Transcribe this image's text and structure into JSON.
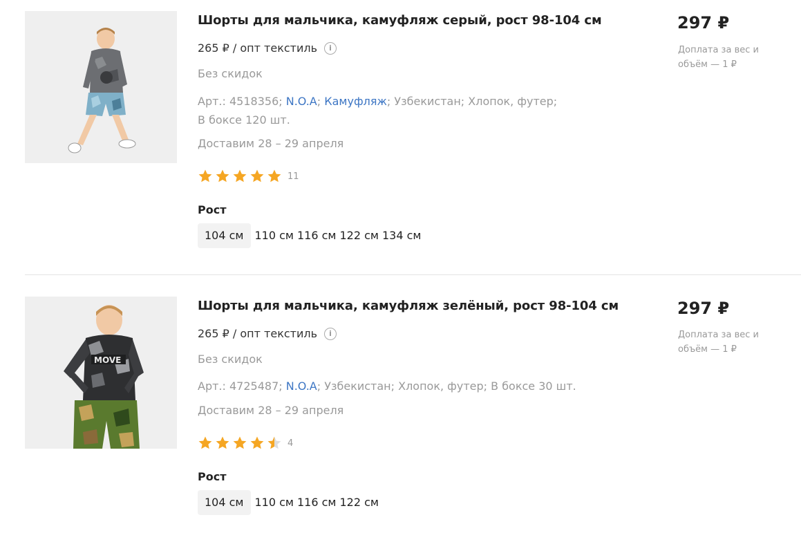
{
  "products": [
    {
      "title": "Шорты для мальчика, камуфляж серый, рост 98-104 см",
      "wholesale_price": "265 ₽ / опт текстиль",
      "discount": "Без скидок",
      "article_prefix": "Арт.: 4518356; ",
      "brand": "N.O.A",
      "sep1": "; ",
      "collection": "Камуфляж",
      "meta_rest": "; Узбекистан; Хлопок, футер;",
      "box": "В боксе 120 шт.",
      "delivery": "Доставим 28 – 29 апреля",
      "rating": 5,
      "rating_count": "11",
      "size_label": "Рост",
      "sizes": [
        "104 см",
        "110 см",
        "116 см",
        "122 см",
        "134 см"
      ],
      "price": "297 ₽",
      "surcharge": "Доплата за вес и объём — 1 ₽"
    },
    {
      "title": "Шорты для мальчика, камуфляж зелёный, рост 98-104 см",
      "wholesale_price": "265 ₽ / опт текстиль",
      "discount": "Без скидок",
      "article_prefix": "Арт.: 4725487; ",
      "brand": "N.O.A",
      "meta_rest": "; Узбекистан; Хлопок, футер; В боксе 30 шт.",
      "delivery": "Доставим 28 – 29 апреля",
      "rating": 4.5,
      "rating_count": "4",
      "size_label": "Рост",
      "sizes": [
        "104 см",
        "110 см",
        "116 см",
        "122 см"
      ],
      "price": "297 ₽",
      "surcharge": "Доплата за вес и объём — 1 ₽"
    }
  ],
  "colors": {
    "star": "#f5a623",
    "star_empty": "#dddddd",
    "link": "#3d76c4"
  },
  "icons": {
    "info": "info-icon",
    "star": "star-icon"
  }
}
